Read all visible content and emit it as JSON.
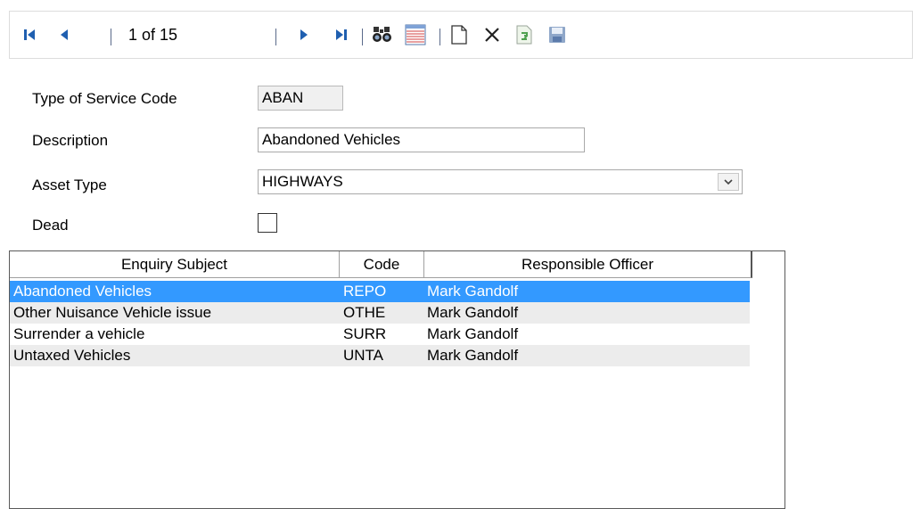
{
  "toolbar": {
    "record_counter": "1 of 15",
    "icons": [
      "first-record-icon",
      "previous-record-icon",
      "next-record-icon",
      "last-record-icon",
      "find-icon",
      "list-view-icon",
      "new-record-icon",
      "delete-icon",
      "copy-record-icon",
      "save-icon"
    ]
  },
  "form": {
    "type_of_service_code": {
      "label": "Type of Service Code",
      "value": "ABAN"
    },
    "description": {
      "label": "Description",
      "value": "Abandoned Vehicles"
    },
    "asset_type": {
      "label": "Asset Type",
      "value": "HIGHWAYS"
    },
    "dead": {
      "label": "Dead",
      "checked": false
    }
  },
  "grid": {
    "columns": [
      "Enquiry Subject",
      "Code",
      "Responsible Officer"
    ],
    "rows": [
      {
        "subject": "Abandoned Vehicles",
        "code": "REPO",
        "officer": "Mark Gandolf",
        "selected": true
      },
      {
        "subject": "Other Nuisance Vehicle issue",
        "code": "OTHE",
        "officer": "Mark Gandolf",
        "selected": false
      },
      {
        "subject": "Surrender a vehicle",
        "code": "SURR",
        "officer": "Mark Gandolf",
        "selected": false
      },
      {
        "subject": "Untaxed Vehicles",
        "code": "UNTA",
        "officer": "Mark Gandolf",
        "selected": false
      }
    ]
  },
  "colors": {
    "selection": "#3399ff",
    "alt_row": "#ececec",
    "nav_icon": "#1f5fb0"
  }
}
